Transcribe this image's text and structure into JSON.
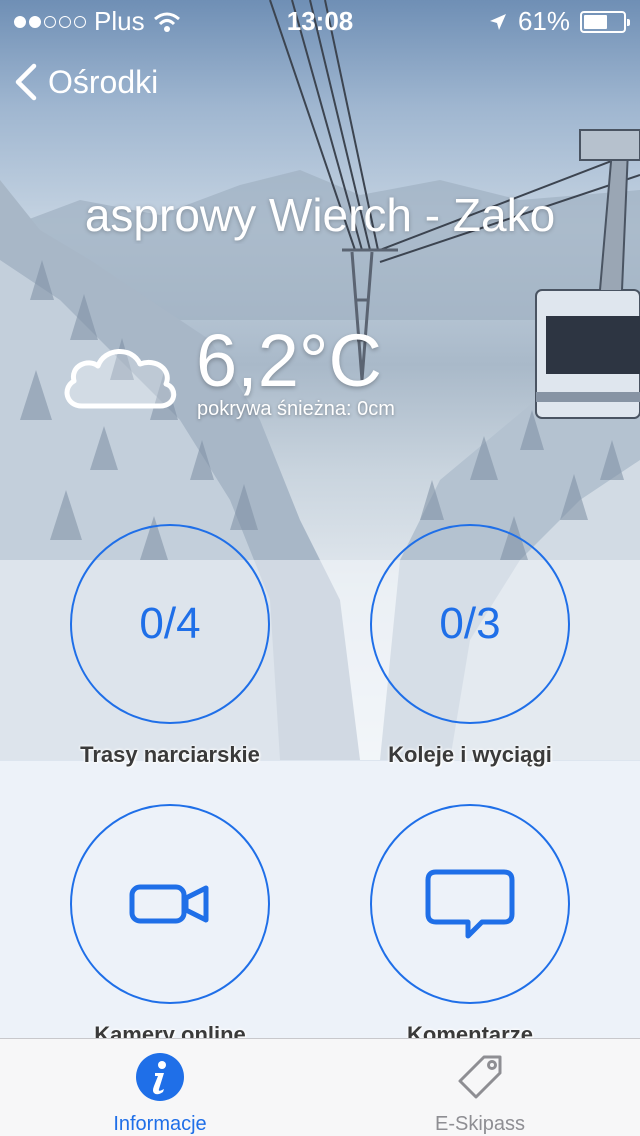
{
  "status_bar": {
    "carrier": "Plus",
    "time": "13:08",
    "battery": "61%",
    "battery_level": 0.61
  },
  "nav": {
    "back_label": "Ośrodki"
  },
  "resort": {
    "title": "asprowy Wierch - Zako"
  },
  "weather": {
    "icon": "cloud-icon",
    "temperature": "6,2°C",
    "snow_cover": "pokrywa śnieżna: 0cm"
  },
  "tiles": [
    {
      "value": "0/4",
      "label": "Trasy narciarskie"
    },
    {
      "value": "0/3",
      "label": "Koleje i wyciągi"
    },
    {
      "icon": "video-camera-icon",
      "label": "Kamery online"
    },
    {
      "icon": "comment-icon",
      "label": "Komentarze"
    }
  ],
  "tab_bar": {
    "items": [
      {
        "label": "Informacje",
        "icon": "info-icon",
        "active": true
      },
      {
        "label": "E-Skipass",
        "icon": "tag-icon",
        "active": false
      }
    ]
  },
  "colors": {
    "accent": "#1f6fe8",
    "tab_inactive": "#8e8e93",
    "panel": "#edf2f9"
  }
}
